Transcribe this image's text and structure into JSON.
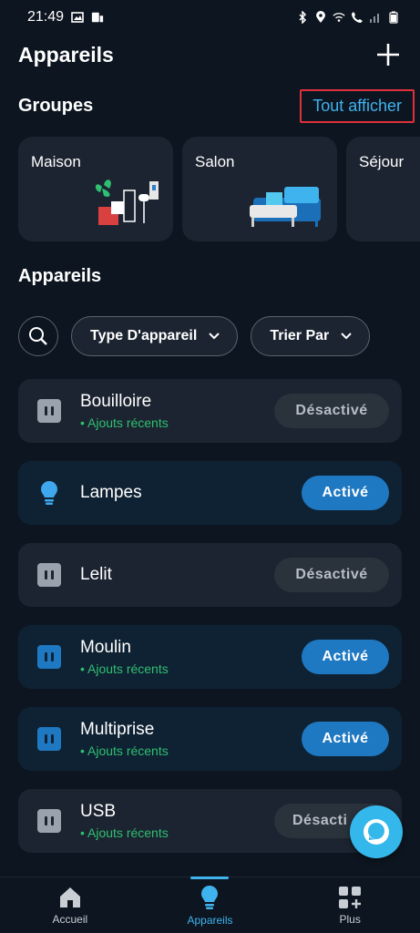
{
  "status_bar": {
    "time": "21:49"
  },
  "header": {
    "title": "Appareils"
  },
  "groups": {
    "title": "Groupes",
    "show_all": "Tout afficher",
    "cards": [
      {
        "label": "Maison"
      },
      {
        "label": "Salon"
      },
      {
        "label": "Séjour"
      }
    ]
  },
  "devices": {
    "title": "Appareils",
    "filters": {
      "type": "Type D'appareil",
      "sort": "Trier Par"
    },
    "items": [
      {
        "name": "Bouilloire",
        "subtitle": "• Ajouts récents",
        "state": "Désactivé",
        "icon": "plug-icon"
      },
      {
        "name": "Lampes",
        "subtitle": "",
        "state": "Activé",
        "icon": "bulb-icon"
      },
      {
        "name": "Lelit",
        "subtitle": "",
        "state": "Désactivé",
        "icon": "plug-icon"
      },
      {
        "name": "Moulin",
        "subtitle": "• Ajouts récents",
        "state": "Activé",
        "icon": "plug-icon"
      },
      {
        "name": "Multiprise",
        "subtitle": "• Ajouts récents",
        "state": "Activé",
        "icon": "plug-icon"
      },
      {
        "name": "USB",
        "subtitle": "• Ajouts récents",
        "state": "Désacti",
        "icon": "plug-icon"
      }
    ]
  },
  "bottom_nav": {
    "items": [
      {
        "label": "Accueil",
        "icon": "home-icon"
      },
      {
        "label": "Appareils",
        "icon": "bulb-icon"
      },
      {
        "label": "Plus",
        "icon": "plus-grid-icon"
      }
    ]
  },
  "colors": {
    "accent": "#3fb3ee",
    "active": "#1e78c2",
    "recent": "#2fbf71",
    "background": "#0d1520",
    "card": "#1b2430"
  }
}
